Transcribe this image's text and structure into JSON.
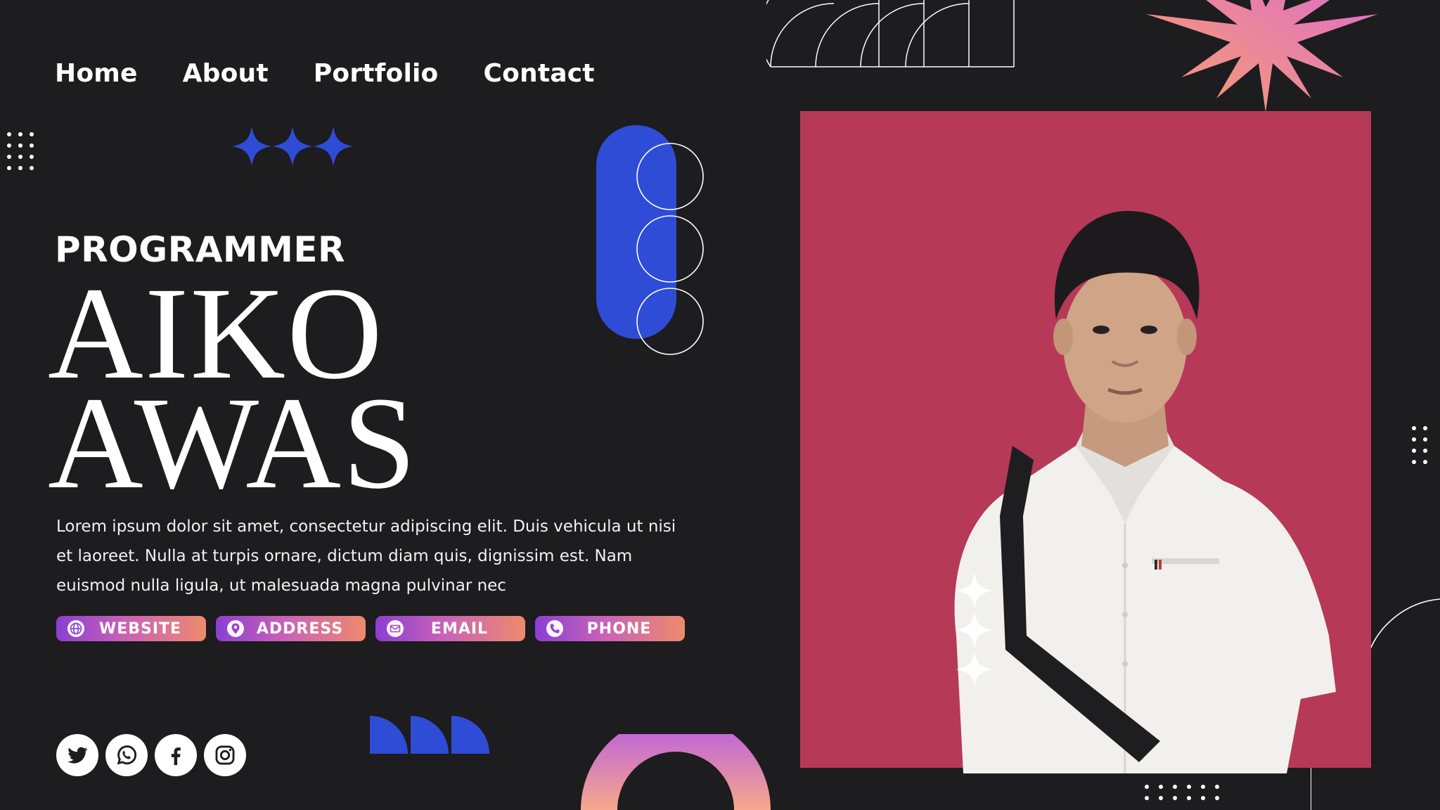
{
  "nav": {
    "items": [
      "Home",
      "About",
      "Portfolio",
      "Contact"
    ]
  },
  "hero": {
    "role": "PROGRAMMER",
    "name_line1": "AIKO",
    "name_line2": "AWAS",
    "description": "Lorem ipsum dolor sit amet, consectetur adipiscing elit. Duis vehicula ut nisi et laoreet. Nulla at turpis ornare, dictum diam quis, dignissim est. Nam euismod nulla ligula, ut malesuada magna pulvinar nec"
  },
  "contact_pills": [
    {
      "label": "WEBSITE",
      "icon": "globe-icon"
    },
    {
      "label": "ADDRESS",
      "icon": "location-pin-icon"
    },
    {
      "label": "EMAIL",
      "icon": "envelope-icon"
    },
    {
      "label": "PHONE",
      "icon": "phone-icon"
    }
  ],
  "socials": [
    "twitter-icon",
    "whatsapp-icon",
    "facebook-icon",
    "instagram-icon"
  ],
  "colors": {
    "background": "#1d1c1e",
    "panel": "#b63958",
    "accent_blue": "#2f4cd6",
    "pill_gradient_start": "#8a3fd2",
    "pill_gradient_end": "#ee8a6c"
  }
}
